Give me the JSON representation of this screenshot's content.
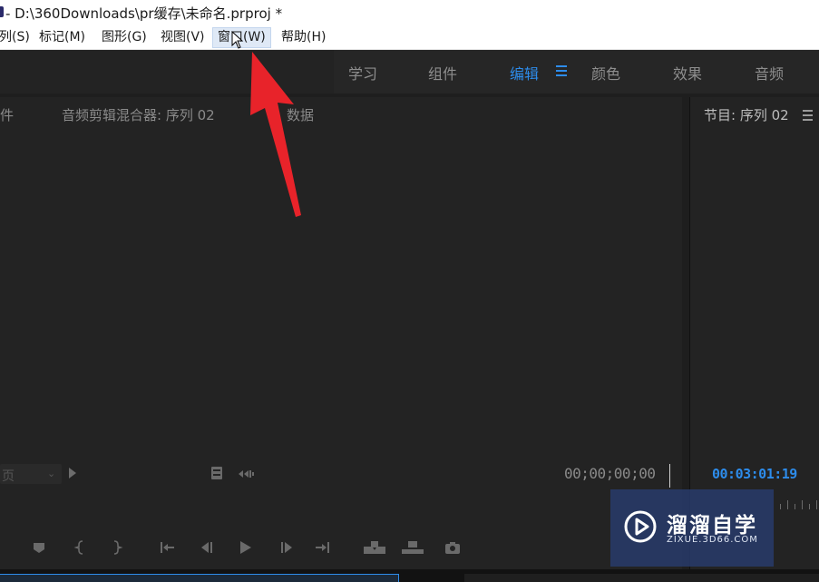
{
  "window": {
    "title": "- D:\\360Downloads\\pr缓存\\未命名.prproj *"
  },
  "menubar": {
    "items": [
      {
        "label": "列(S)"
      },
      {
        "label": "标记(M)"
      },
      {
        "label": "图形(G)"
      },
      {
        "label": "视图(V)"
      },
      {
        "label": "窗口(W)",
        "hovered": true
      },
      {
        "label": "帮助(H)"
      }
    ]
  },
  "workspaces": {
    "tabs": [
      {
        "label": "学习"
      },
      {
        "label": "组件"
      },
      {
        "label": "编辑",
        "active": true
      },
      {
        "label": "颜色"
      },
      {
        "label": "效果"
      },
      {
        "label": "音频"
      }
    ],
    "active_color": "#2d8ceb"
  },
  "left_panel": {
    "tabs": [
      {
        "label": "件"
      },
      {
        "label": "音频剪辑混合器: 序列 02"
      },
      {
        "label": "数据"
      }
    ],
    "pager_label": "页",
    "timecode": "00;00;00;00",
    "controls": [
      "add-marker-icon",
      "mark-in-icon",
      "mark-out-icon",
      "go-to-in-icon",
      "step-back-icon",
      "play-icon",
      "step-forward-icon",
      "go-to-out-icon",
      "insert-icon",
      "overwrite-icon",
      "export-frame-icon"
    ]
  },
  "right_panel": {
    "title": "节目: 序列 02",
    "timecode": "00:03:01:19"
  },
  "watermark": {
    "main": "溜溜自学",
    "sub": "ZIXUE.3D66.COM"
  },
  "annotation": {
    "color": "#e8232a"
  }
}
